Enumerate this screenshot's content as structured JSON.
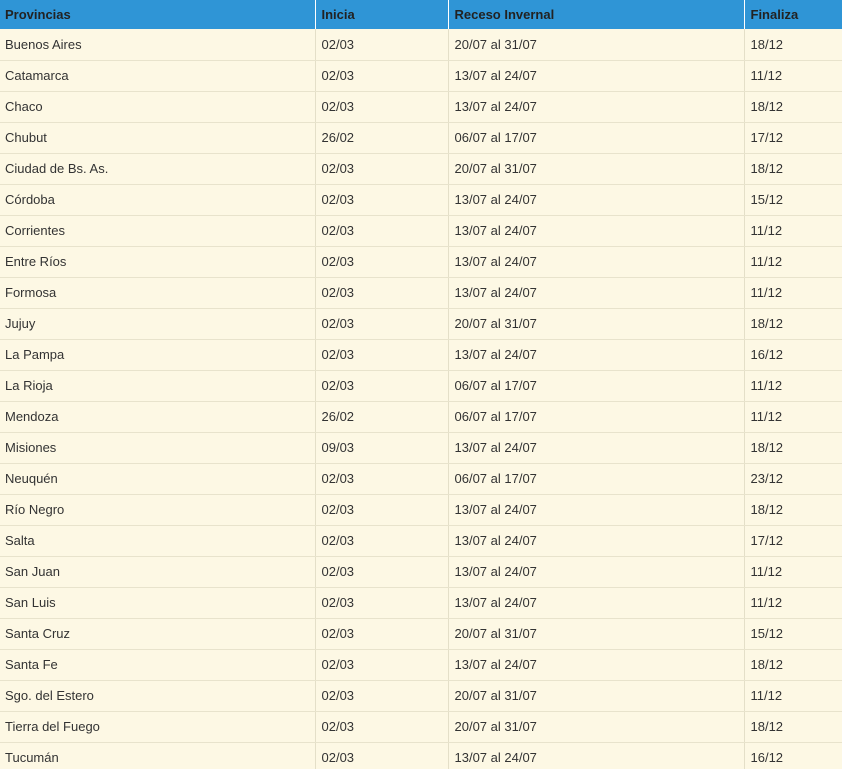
{
  "table": {
    "headers": [
      "Provincias",
      "Inicia",
      "Receso Invernal",
      "Finaliza"
    ],
    "rows": [
      [
        "Buenos Aires",
        "02/03",
        "20/07 al 31/07",
        "18/12"
      ],
      [
        "Catamarca",
        "02/03",
        "13/07 al 24/07",
        "11/12"
      ],
      [
        "Chaco",
        "02/03",
        "13/07 al 24/07",
        "18/12"
      ],
      [
        "Chubut",
        "26/02",
        "06/07 al 17/07",
        "17/12"
      ],
      [
        "Ciudad de Bs. As.",
        "02/03",
        "20/07 al 31/07",
        "18/12"
      ],
      [
        "Córdoba",
        "02/03",
        "13/07 al 24/07",
        "15/12"
      ],
      [
        "Corrientes",
        "02/03",
        "13/07 al 24/07",
        "11/12"
      ],
      [
        "Entre Ríos",
        "02/03",
        "13/07 al 24/07",
        "11/12"
      ],
      [
        "Formosa",
        "02/03",
        "13/07 al 24/07",
        "11/12"
      ],
      [
        "Jujuy",
        "02/03",
        "20/07 al 31/07",
        "18/12"
      ],
      [
        "La Pampa",
        "02/03",
        "13/07 al 24/07",
        "16/12"
      ],
      [
        "La Rioja",
        "02/03",
        "06/07 al 17/07",
        "11/12"
      ],
      [
        "Mendoza",
        "26/02",
        "06/07 al 17/07",
        "11/12"
      ],
      [
        "Misiones",
        "09/03",
        "13/07 al 24/07",
        "18/12"
      ],
      [
        "Neuquén",
        "02/03",
        "06/07 al 17/07",
        "23/12"
      ],
      [
        "Río Negro",
        "02/03",
        "13/07 al 24/07",
        "18/12"
      ],
      [
        "Salta",
        "02/03",
        "13/07 al 24/07",
        "17/12"
      ],
      [
        "San Juan",
        "02/03",
        "13/07 al 24/07",
        "11/12"
      ],
      [
        "San Luis",
        "02/03",
        "13/07 al 24/07",
        "11/12"
      ],
      [
        "Santa Cruz",
        "02/03",
        "20/07 al 31/07",
        "15/12"
      ],
      [
        "Santa Fe",
        "02/03",
        "13/07 al 24/07",
        "18/12"
      ],
      [
        "Sgo. del Estero",
        "02/03",
        "20/07 al 31/07",
        "11/12"
      ],
      [
        "Tierra del Fuego",
        "02/03",
        "20/07 al 31/07",
        "18/12"
      ],
      [
        "Tucumán",
        "02/03",
        "13/07 al 24/07",
        "16/12"
      ]
    ]
  },
  "colors": {
    "header_bg": "#2f95d6",
    "row_bg": "#fdf8e4",
    "text": "#333333"
  }
}
